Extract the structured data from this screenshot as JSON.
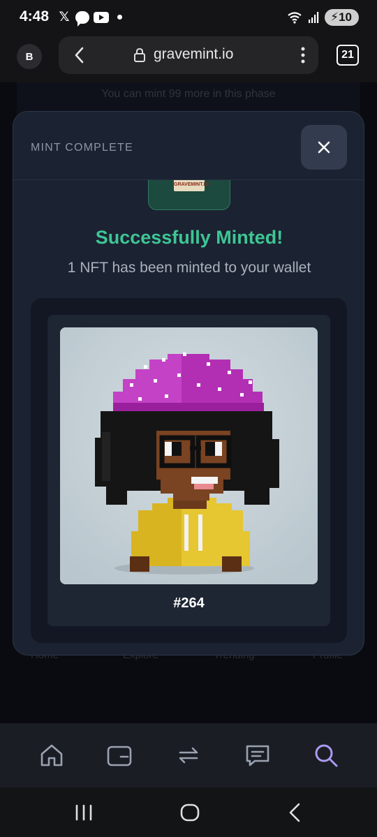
{
  "status_bar": {
    "time": "4:48",
    "x_glyph": "𝕏",
    "battery": "10",
    "icons": [
      "x-icon",
      "chat-bubble-icon",
      "youtube-icon",
      "dot-icon",
      "wifi-icon",
      "signal-icon",
      "battery-icon"
    ]
  },
  "browser": {
    "profile_initial": "B",
    "url": "gravemint.io",
    "tab_count": "21"
  },
  "page": {
    "mint_limit": "You can mint 99 more in this phase",
    "nav_labels": [
      "Home",
      "Explore",
      "Trending",
      "Profile"
    ]
  },
  "modal": {
    "title": "MINT COMPLETE",
    "logo_text": "GRAVEMINT.IO",
    "success": "Successfully Minted!",
    "subtitle": "1 NFT has been minted to your wallet",
    "nft_id": "#264"
  },
  "app_nav": {
    "items": [
      "home-icon",
      "wallet-icon",
      "swap-icon",
      "messages-icon",
      "search-icon"
    ],
    "active": "search-icon",
    "active_color": "#a99bf2"
  },
  "colors": {
    "accent_green": "#3ec694",
    "modal_bg": "#1b2232"
  }
}
